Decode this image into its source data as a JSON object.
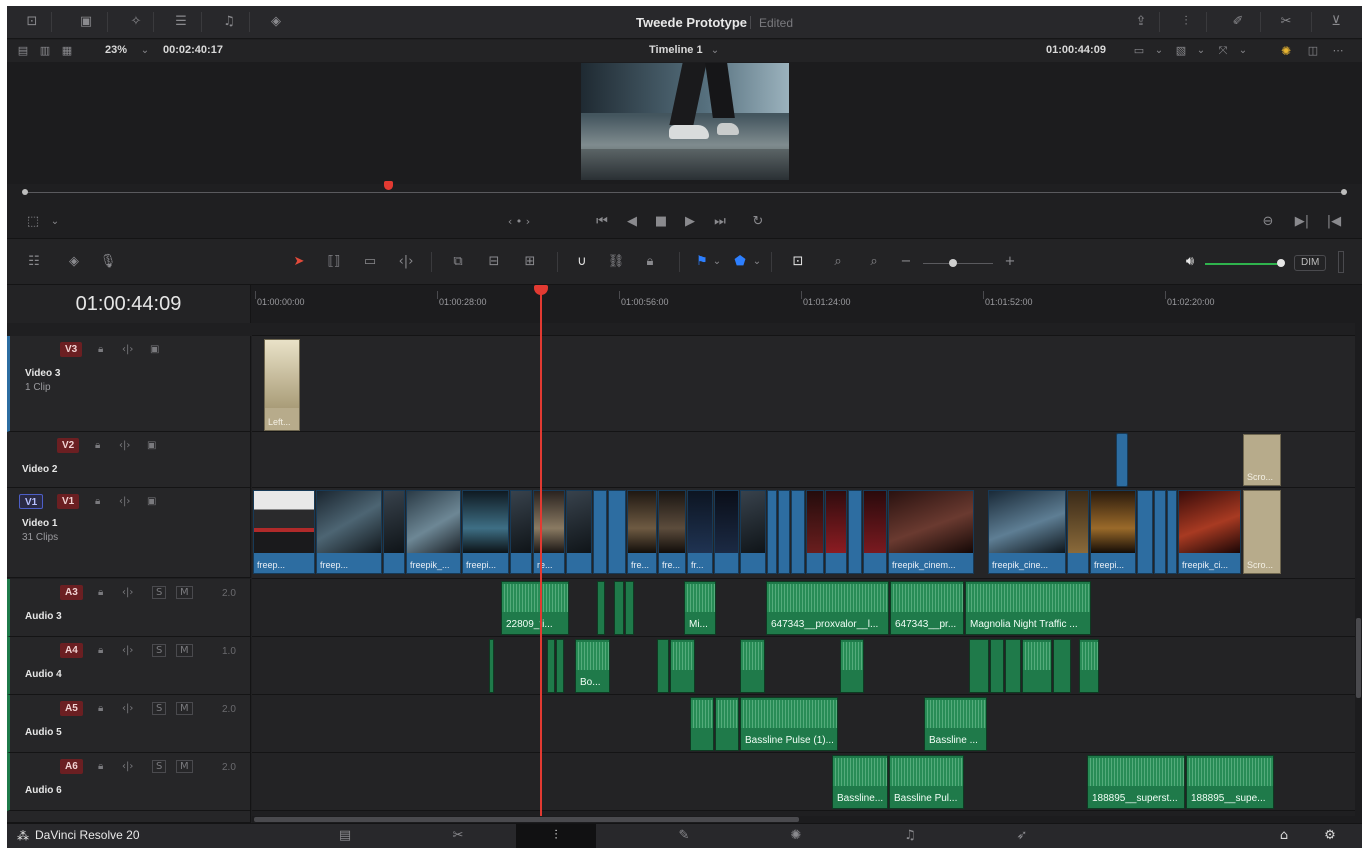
{
  "project": {
    "title": "Tweede Prototype",
    "status": "Edited"
  },
  "viewer": {
    "zoom": "23%",
    "duration": "00:02:40:17",
    "timeline_name": "Timeline 1",
    "timecode": "01:00:44:09"
  },
  "timeline": {
    "current_timecode": "01:00:44:09",
    "ruler_labels": [
      "01:00:00:00",
      "01:00:28:00",
      "01:00:56:00",
      "01:01:24:00",
      "01:01:52:00",
      "01:02:20:00"
    ]
  },
  "audio_meter": {
    "dim_label": "DIM"
  },
  "tracks": {
    "v3": {
      "badge": "V3",
      "name": "Video 3",
      "sub": "1 Clip"
    },
    "v2": {
      "badge": "V2",
      "name": "Video 2",
      "sub": ""
    },
    "v1": {
      "src_badge": "V1",
      "badge": "V1",
      "name": "Video 1",
      "sub": "31 Clips"
    },
    "a3": {
      "badge": "A3",
      "name": "Audio 3",
      "level": "2.0"
    },
    "a4": {
      "badge": "A4",
      "name": "Audio 4",
      "level": "1.0"
    },
    "a5": {
      "badge": "A5",
      "name": "Audio 5",
      "level": "2.0"
    },
    "a6": {
      "badge": "A6",
      "name": "Audio 6",
      "level": "2.0"
    },
    "solo_label": "S",
    "mute_label": "M"
  },
  "clips": {
    "v3_left": "Left...",
    "v2_scro": "Scro...",
    "v1_labels": [
      "freep...",
      "freep...",
      "freepik_...",
      "freepi...",
      "re...",
      "fre...",
      "fre...",
      "fr...",
      "freepik_cinem...",
      "freepik_cine...",
      "freepi...",
      "freepik_ci...",
      "Scro..."
    ],
    "a3_labels": [
      "22809_ti...",
      "Mi...",
      "647343__proxvalor__l...",
      "647343__pr...",
      "Magnolia Night Traffic ..."
    ],
    "a4_labels": [
      "Bo..."
    ],
    "a5_labels": [
      "Bassline Pulse (1)...",
      "Bassline ..."
    ],
    "a6_labels": [
      "Bassline...",
      "Bassline Pul...",
      "188895__superst...",
      "188895__supe..."
    ]
  },
  "footer": {
    "app_name": "DaVinci Resolve 20"
  },
  "colors": {
    "clip_video": "#2d6da1",
    "clip_audio": "#1f7a4a",
    "playhead": "#e23a32",
    "track_badge": "#6b1f22"
  }
}
